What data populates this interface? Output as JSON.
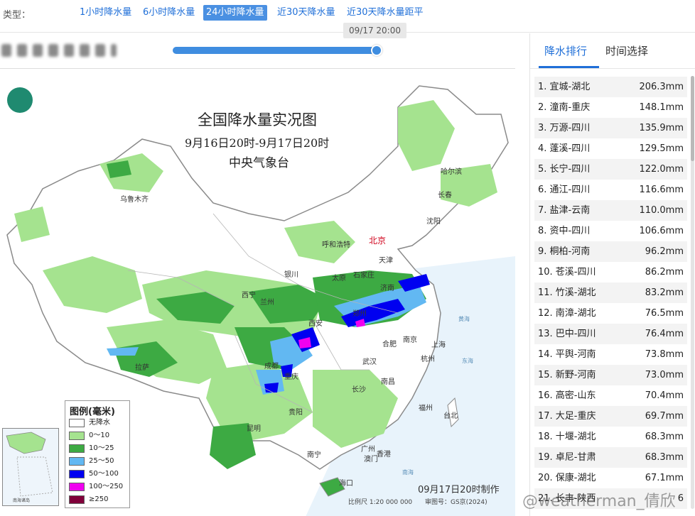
{
  "type_bar": {
    "label": "类型：",
    "tabs": [
      {
        "label": "1小时降水量",
        "active": false
      },
      {
        "label": "6小时降水量",
        "active": false
      },
      {
        "label": "24小时降水量",
        "active": true
      },
      {
        "label": "近30天降水量",
        "active": false
      },
      {
        "label": "近30天降水量距平",
        "active": false
      }
    ]
  },
  "slider": {
    "time_label": "09/17 20:00",
    "progress": 1.0
  },
  "map": {
    "title": "全国降水量实况图",
    "subtitle": "9月16日20时-9月17日20时",
    "organization": "中央气象台",
    "cities": [
      "乌鲁木齐",
      "哈尔滨",
      "长春",
      "沈阳",
      "北京",
      "天津",
      "呼和浩特",
      "石家庄",
      "太原",
      "银川",
      "济南",
      "兰州",
      "西宁",
      "郑州",
      "西安",
      "南京",
      "上海",
      "合肥",
      "武汉",
      "杭州",
      "成都",
      "重庆",
      "南昌",
      "拉萨",
      "长沙",
      "贵阳",
      "福州",
      "台北",
      "昆明",
      "南宁",
      "广州",
      "香港",
      "澳门",
      "海口"
    ],
    "seas": [
      "黄海",
      "东海",
      "南海"
    ],
    "footer_made": "09月17日20时制作",
    "footer_scale": "比例尺 1:20 000 000",
    "footer_gs": "审图号：GS京(2024)",
    "legend": {
      "title": "图例(毫米)",
      "items": [
        {
          "label": "无降水",
          "color": "#ffffff"
        },
        {
          "label": "0～10",
          "color": "#a5e38f"
        },
        {
          "label": "10～25",
          "color": "#3daa43"
        },
        {
          "label": "25～50",
          "color": "#62b8f2"
        },
        {
          "label": "50～100",
          "color": "#0000f0"
        },
        {
          "label": "100～250",
          "color": "#f000f0"
        },
        {
          "label": "≥250",
          "color": "#80003a"
        }
      ]
    },
    "inset_label": "南海诸岛"
  },
  "right_panel": {
    "tabs": [
      {
        "label": "降水排行",
        "active": true
      },
      {
        "label": "时间选择",
        "active": false
      }
    ],
    "ranking": [
      {
        "name": "1. 宜城-湖北",
        "value": "206.3mm"
      },
      {
        "name": "2. 潼南-重庆",
        "value": "148.1mm"
      },
      {
        "name": "3. 万源-四川",
        "value": "135.9mm"
      },
      {
        "name": "4. 蓬溪-四川",
        "value": "129.5mm"
      },
      {
        "name": "5. 长宁-四川",
        "value": "122.0mm"
      },
      {
        "name": "6. 通江-四川",
        "value": "116.6mm"
      },
      {
        "name": "7. 盐津-云南",
        "value": "110.0mm"
      },
      {
        "name": "8. 资中-四川",
        "value": "106.6mm"
      },
      {
        "name": "9. 桐柏-河南",
        "value": "96.2mm"
      },
      {
        "name": "10. 苍溪-四川",
        "value": "86.2mm"
      },
      {
        "name": "11. 竹溪-湖北",
        "value": "83.2mm"
      },
      {
        "name": "12. 南漳-湖北",
        "value": "76.5mm"
      },
      {
        "name": "13. 巴中-四川",
        "value": "76.4mm"
      },
      {
        "name": "14. 平舆-河南",
        "value": "73.8mm"
      },
      {
        "name": "15. 新野-河南",
        "value": "73.0mm"
      },
      {
        "name": "16. 高密-山东",
        "value": "70.4mm"
      },
      {
        "name": "17. 大足-重庆",
        "value": "69.7mm"
      },
      {
        "name": "18. 十堰-湖北",
        "value": "68.3mm"
      },
      {
        "name": "19. 卓尼-甘肃",
        "value": "68.3mm"
      },
      {
        "name": "20. 保康-湖北",
        "value": "67.1mm"
      },
      {
        "name": "21. 长丰-陕西",
        "value": "6"
      }
    ]
  },
  "watermark": "@weatherman_倩欣"
}
